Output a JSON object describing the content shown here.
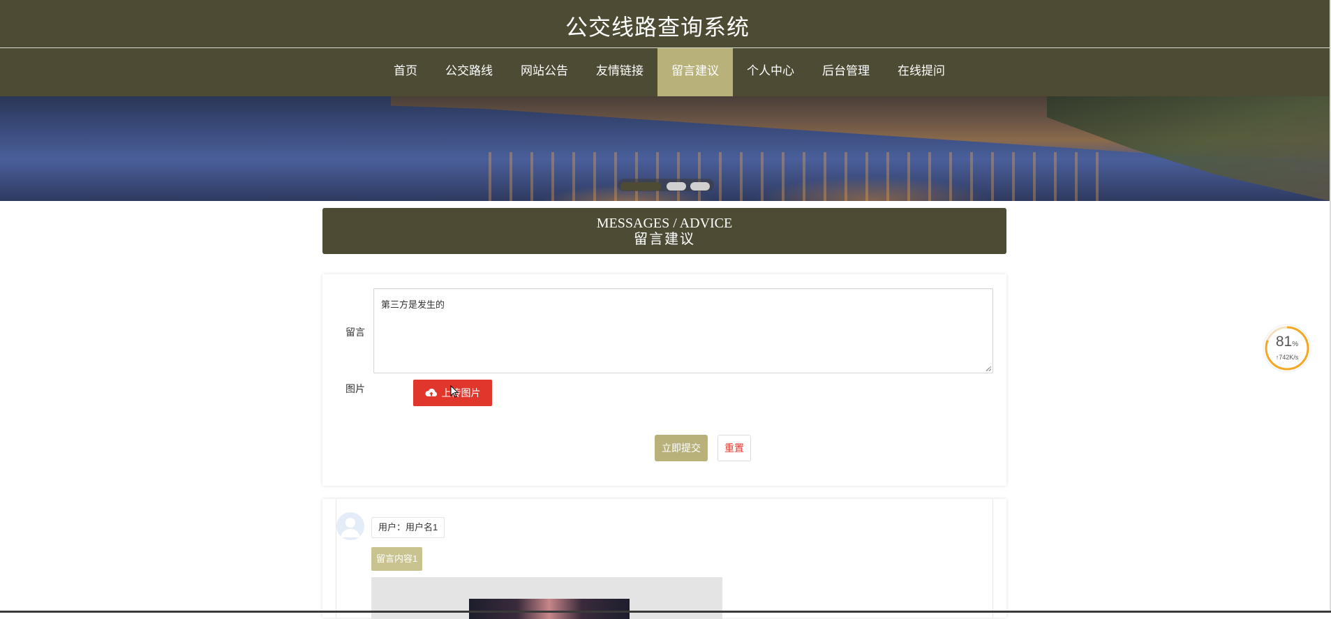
{
  "header": {
    "site_title": "公交线路查询系统"
  },
  "nav": {
    "items": [
      {
        "label": "首页"
      },
      {
        "label": "公交路线"
      },
      {
        "label": "网站公告"
      },
      {
        "label": "友情链接"
      },
      {
        "label": "留言建议",
        "active": true
      },
      {
        "label": "个人中心"
      },
      {
        "label": "后台管理"
      },
      {
        "label": "在线提问"
      }
    ]
  },
  "banner": {
    "carousel_count": 3,
    "active_index": 0
  },
  "section": {
    "title_en": "MESSAGES / ADVICE",
    "title_zh": "留言建议"
  },
  "form": {
    "message_label": "留言",
    "message_value": "第三方是发生的",
    "image_label": "图片",
    "upload_label": "上传图片",
    "submit_label": "立即提交",
    "reset_label": "重置"
  },
  "messages": [
    {
      "user": "用户：用户名1",
      "content": "留言内容1"
    }
  ],
  "speed_widget": {
    "percent": "81",
    "percent_unit": "%",
    "rate": "↑742K/s"
  },
  "colors": {
    "primary": "#4d4b34",
    "accent": "#b8b27a",
    "danger": "#e0362c"
  },
  "icons": {
    "upload": "cloud-upload-icon",
    "avatar": "user-avatar-icon"
  }
}
